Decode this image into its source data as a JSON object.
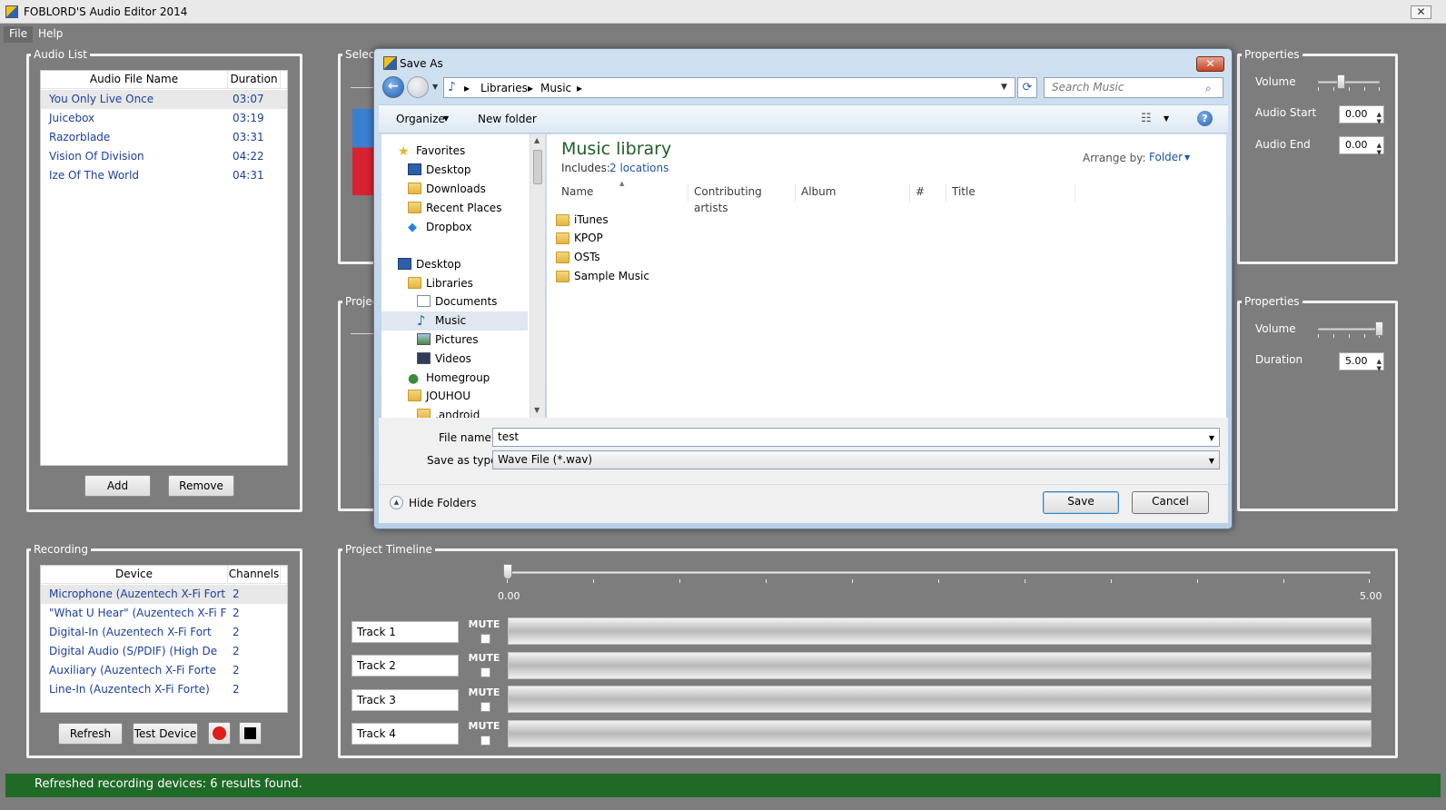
{
  "window": {
    "title": "FOBLORD'S Audio Editor 2014",
    "close_glyph": "✕"
  },
  "menu": {
    "file": "File",
    "help": "Help"
  },
  "audio_list": {
    "group_label": "Audio List",
    "col_name": "Audio File Name",
    "col_duration": "Duration",
    "rows": [
      {
        "name": "You Only Live Once",
        "duration": "03:07"
      },
      {
        "name": "Juicebox",
        "duration": "03:19"
      },
      {
        "name": "Razorblade",
        "duration": "03:31"
      },
      {
        "name": "Vision Of Division",
        "duration": "04:22"
      },
      {
        "name": "Ize Of The World",
        "duration": "04:31"
      }
    ],
    "add_label": "Add",
    "remove_label": "Remove"
  },
  "select_group": {
    "label": "Select"
  },
  "project_group": {
    "label": "Projec"
  },
  "properties_top": {
    "label": "Properties",
    "volume_label": "Volume",
    "volume_level": 0.35,
    "audio_start_label": "Audio Start",
    "audio_start_value": "0.00",
    "audio_end_label": "Audio End",
    "audio_end_value": "0.00"
  },
  "properties_bottom": {
    "label": "Properties",
    "volume_label": "Volume",
    "volume_level": 1.0,
    "duration_label": "Duration",
    "duration_value": "5.00"
  },
  "recording": {
    "group_label": "Recording",
    "col_device": "Device",
    "col_channels": "Channels",
    "rows": [
      {
        "device": "Microphone (Auzentech X-Fi Fort",
        "channels": "2"
      },
      {
        "device": "\"What U Hear\" (Auzentech X-Fi F",
        "channels": "2"
      },
      {
        "device": "Digital-In (Auzentech X-Fi Fort",
        "channels": "2"
      },
      {
        "device": "Digital Audio (S/PDIF) (High De",
        "channels": "2"
      },
      {
        "device": "Auxiliary (Auzentech X-Fi Forte",
        "channels": "2"
      },
      {
        "device": "Line-In (Auzentech X-Fi Forte)",
        "channels": "2"
      }
    ],
    "refresh_label": "Refresh",
    "test_label": "Test Device",
    "record_color": "#e11b1b",
    "stop_color": "#000000"
  },
  "timeline": {
    "group_label": "Project Timeline",
    "start": "0.00",
    "end": "5.00",
    "position": 0.0,
    "mute_label": "MUTE",
    "tracks": [
      {
        "name": "Track 1"
      },
      {
        "name": "Track 2"
      },
      {
        "name": "Track 3"
      },
      {
        "name": "Track 4"
      }
    ]
  },
  "status": {
    "text": "Refreshed recording devices: 6 results found.",
    "color": "#1e6a26"
  },
  "dialog": {
    "title": "Save As",
    "breadcrumb": [
      "Libraries",
      "Music"
    ],
    "search_placeholder": "Search Music",
    "organize": "Organize",
    "new_folder": "New folder",
    "help_glyph": "?",
    "nav": [
      {
        "label": "Favorites",
        "icon": "star-icon"
      },
      {
        "label": "Desktop",
        "icon": "desktop-icon"
      },
      {
        "label": "Downloads",
        "icon": "downloads-folder-icon"
      },
      {
        "label": "Recent Places",
        "icon": "recent-places-icon"
      },
      {
        "label": "Dropbox",
        "icon": "dropbox-icon"
      },
      {
        "label": "Desktop",
        "icon": "desktop-icon"
      },
      {
        "label": "Libraries",
        "icon": "libraries-icon"
      },
      {
        "label": "Documents",
        "icon": "documents-icon"
      },
      {
        "label": "Music",
        "icon": "music-note-icon"
      },
      {
        "label": "Pictures",
        "icon": "pictures-icon"
      },
      {
        "label": "Videos",
        "icon": "videos-icon"
      },
      {
        "label": "Homegroup",
        "icon": "homegroup-icon"
      },
      {
        "label": "JOUHOU",
        "icon": "user-folder-icon"
      },
      {
        "label": ".android",
        "icon": "folder-icon"
      }
    ],
    "library_title": "Music library",
    "includes_label": "Includes:",
    "includes_link": "2 locations",
    "arrange_label": "Arrange by:",
    "arrange_value": "Folder",
    "columns": [
      "Name",
      "Contributing artists",
      "Album",
      "#",
      "Title"
    ],
    "files": [
      "iTunes",
      "KPOP",
      "OSTs",
      "Sample Music"
    ],
    "file_name_label": "File name:",
    "file_name_value": "test",
    "save_type_label": "Save as type:",
    "save_type_value": "Wave File (*.wav)",
    "hide_folders": "Hide Folders",
    "save": "Save",
    "cancel": "Cancel"
  }
}
